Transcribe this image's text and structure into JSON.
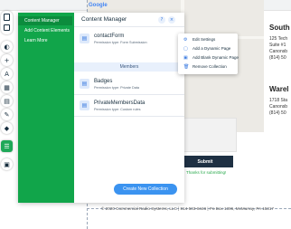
{
  "site": {
    "map_logo": "Google",
    "offices": [
      {
        "title": "South",
        "lines": [
          "125 Tech",
          "Suite #1",
          "Canonsb",
          "(814) 50"
        ]
      },
      {
        "title": "Warel",
        "lines": [
          "1718 Sta",
          "Canonsb",
          "(814) 50"
        ]
      }
    ],
    "submit_label": "Submit",
    "thanks_text": "Thanks for submitting!",
    "footer_text": "© 2020 Commercial Radio Systems, LLC | 814-503-8446 | Po Box 1396, McMurray, PA 15317"
  },
  "cms": {
    "side_items": [
      {
        "label": "Content Manager"
      },
      {
        "label": "Add Content Elements"
      },
      {
        "label": "Learn More"
      }
    ],
    "title": "Content Manager",
    "help_label": "?",
    "close_label": "×",
    "collections": [
      {
        "name": "contactForm",
        "permission": "Permission type: Form Submission"
      },
      {
        "name": "Badges",
        "permission": "Permission type: Private Data"
      },
      {
        "name": "PrivateMembersData",
        "permission": "Permission type: Custom rules"
      }
    ],
    "members_header": "Members",
    "create_label": "Create New Collection",
    "more_label": "⋯"
  },
  "context_menu": {
    "items": [
      {
        "icon": "gear-icon",
        "glyph": "⚙",
        "label": "Edit Settings"
      },
      {
        "icon": "page-icon",
        "glyph": "▢",
        "label": "Add a Dynamic Page"
      },
      {
        "icon": "page-plus-icon",
        "glyph": "▣",
        "label": "Add Blank Dynamic Page"
      },
      {
        "icon": "trash-icon",
        "glyph": "🗑",
        "label": "Remove Collection"
      }
    ]
  },
  "colors": {
    "cms_green": "#11a54a",
    "cms_green_active": "#0c8c3d",
    "accent_blue": "#3b93f0",
    "submit_navy": "#1e3043",
    "thanks_green": "#27a84a"
  }
}
